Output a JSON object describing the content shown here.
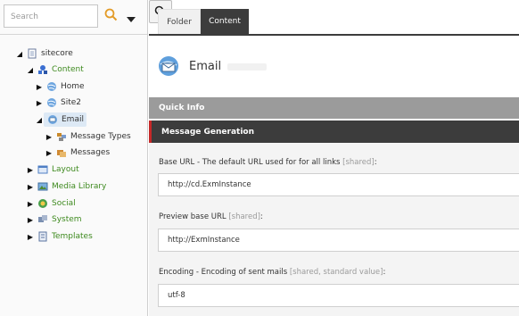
{
  "search": {
    "placeholder": "Search"
  },
  "tree": {
    "sitecore": "sitecore",
    "content": "Content",
    "home": "Home",
    "site2": "Site2",
    "email": "Email",
    "message_types": "Message Types",
    "messages": "Messages",
    "layout": "Layout",
    "media_library": "Media Library",
    "social": "Social",
    "system": "System",
    "templates": "Templates"
  },
  "tabs": {
    "folder": "Folder",
    "content": "Content"
  },
  "item": {
    "title": "Email"
  },
  "sections": {
    "quick_info": "Quick Info",
    "message_generation": "Message Generation"
  },
  "fields": {
    "base_url": {
      "label": "Base URL - The default URL used for for all links ",
      "meta": "[shared]",
      "suffix": ":",
      "value": "http://cd.ExmInstance"
    },
    "preview_url": {
      "label": "Preview base URL ",
      "meta": "[shared]",
      "suffix": ":",
      "value": "http://ExmInstance"
    },
    "encoding": {
      "label": "Encoding - Encoding of sent mails ",
      "meta": "[shared, standard value]",
      "suffix": ":",
      "value": "utf-8"
    }
  },
  "colors": {
    "green_label": "#3e8a1f",
    "dark_bar": "#3c3c3c",
    "accent_red": "#c62828",
    "grey_bar": "#9b9b9b"
  }
}
